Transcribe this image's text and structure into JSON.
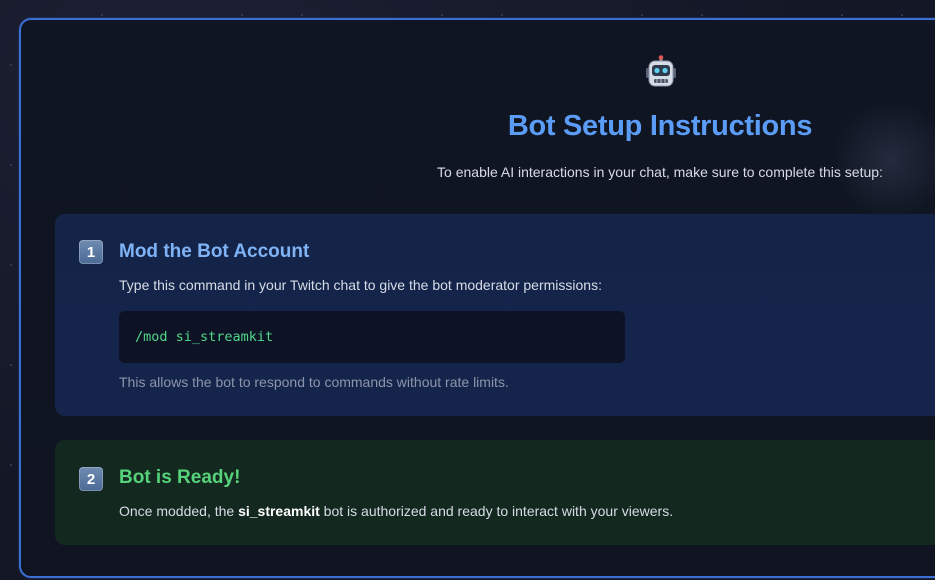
{
  "header": {
    "icon": "robot-icon",
    "title": "Bot Setup Instructions",
    "subtitle": "To enable AI interactions in your chat, make sure to complete this setup:"
  },
  "steps": [
    {
      "number": "1",
      "title": "Mod the Bot Account",
      "description": "Type this command in your Twitch chat to give the bot moderator permissions:",
      "command": "/mod si_streamkit",
      "note": "This allows the bot to respond to commands without rate limits."
    },
    {
      "number": "2",
      "title": "Bot is Ready!",
      "text_before": "Once modded, the ",
      "bot_name": "si_streamkit",
      "text_after": " bot is authorized and ready to interact with your viewers."
    }
  ],
  "colors": {
    "accent": "#5b9cf6",
    "panel_border": "#3b6fd6",
    "step1_bg": "#142449",
    "step2_bg": "#13281f",
    "command_text": "#4fd78a",
    "ready_title": "#56d37a"
  }
}
